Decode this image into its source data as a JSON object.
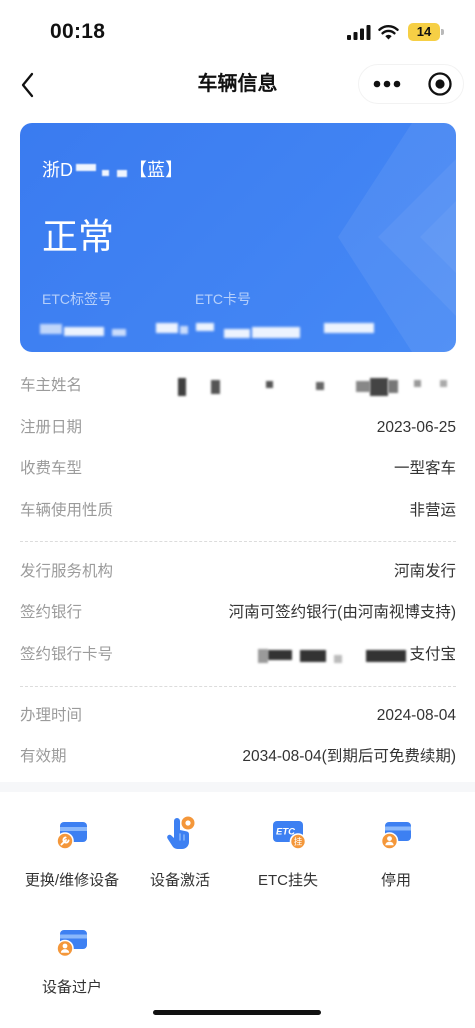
{
  "status_bar": {
    "time": "00:18",
    "battery": "14",
    "icons": [
      "signal-icon",
      "wifi-icon",
      "battery-icon"
    ]
  },
  "header": {
    "title": "车辆信息",
    "back_icon": "back-arrow-icon",
    "more_icon": "more-dots-icon",
    "target_icon": "target-circle-icon"
  },
  "card": {
    "plate_prefix": "浙D",
    "plate_color": "【蓝】",
    "status": "正常",
    "tag_label": "ETC标签号",
    "card_no_label": "ETC卡号"
  },
  "info_rows": [
    {
      "label": "车主姓名"
    },
    {
      "label": "注册日期",
      "value": "2023-06-25"
    },
    {
      "label": "收费车型",
      "value": "一型客车"
    },
    {
      "label": "车辆使用性质",
      "value": "非营运"
    },
    {
      "label": "发行服务机构",
      "value": "河南发行"
    },
    {
      "label": "签约银行",
      "value": "河南可签约银行(由河南视博支持)"
    },
    {
      "label": "签约银行卡号",
      "value_suffix": "支付宝"
    },
    {
      "label": "办理时间",
      "value": "2024-08-04"
    },
    {
      "label": "有效期",
      "value": "2034-08-04(到期后可免费续期)"
    }
  ],
  "actions": [
    {
      "label": "更换/维修设备",
      "icon": "card-wrench-icon"
    },
    {
      "label": "设备激活",
      "icon": "hand-tap-icon"
    },
    {
      "label": "ETC挂失",
      "icon": "etc-report-loss-icon",
      "icon_text": "ETC",
      "badge_text": "挂"
    },
    {
      "label": "停用",
      "icon": "card-person-icon"
    },
    {
      "label": "设备过户",
      "icon": "card-transfer-icon"
    }
  ],
  "colors": {
    "primary": "#3d80f2",
    "accent": "#f4973a",
    "label": "#9b9b9b",
    "value": "#333333",
    "battery": "#f6cf45"
  }
}
